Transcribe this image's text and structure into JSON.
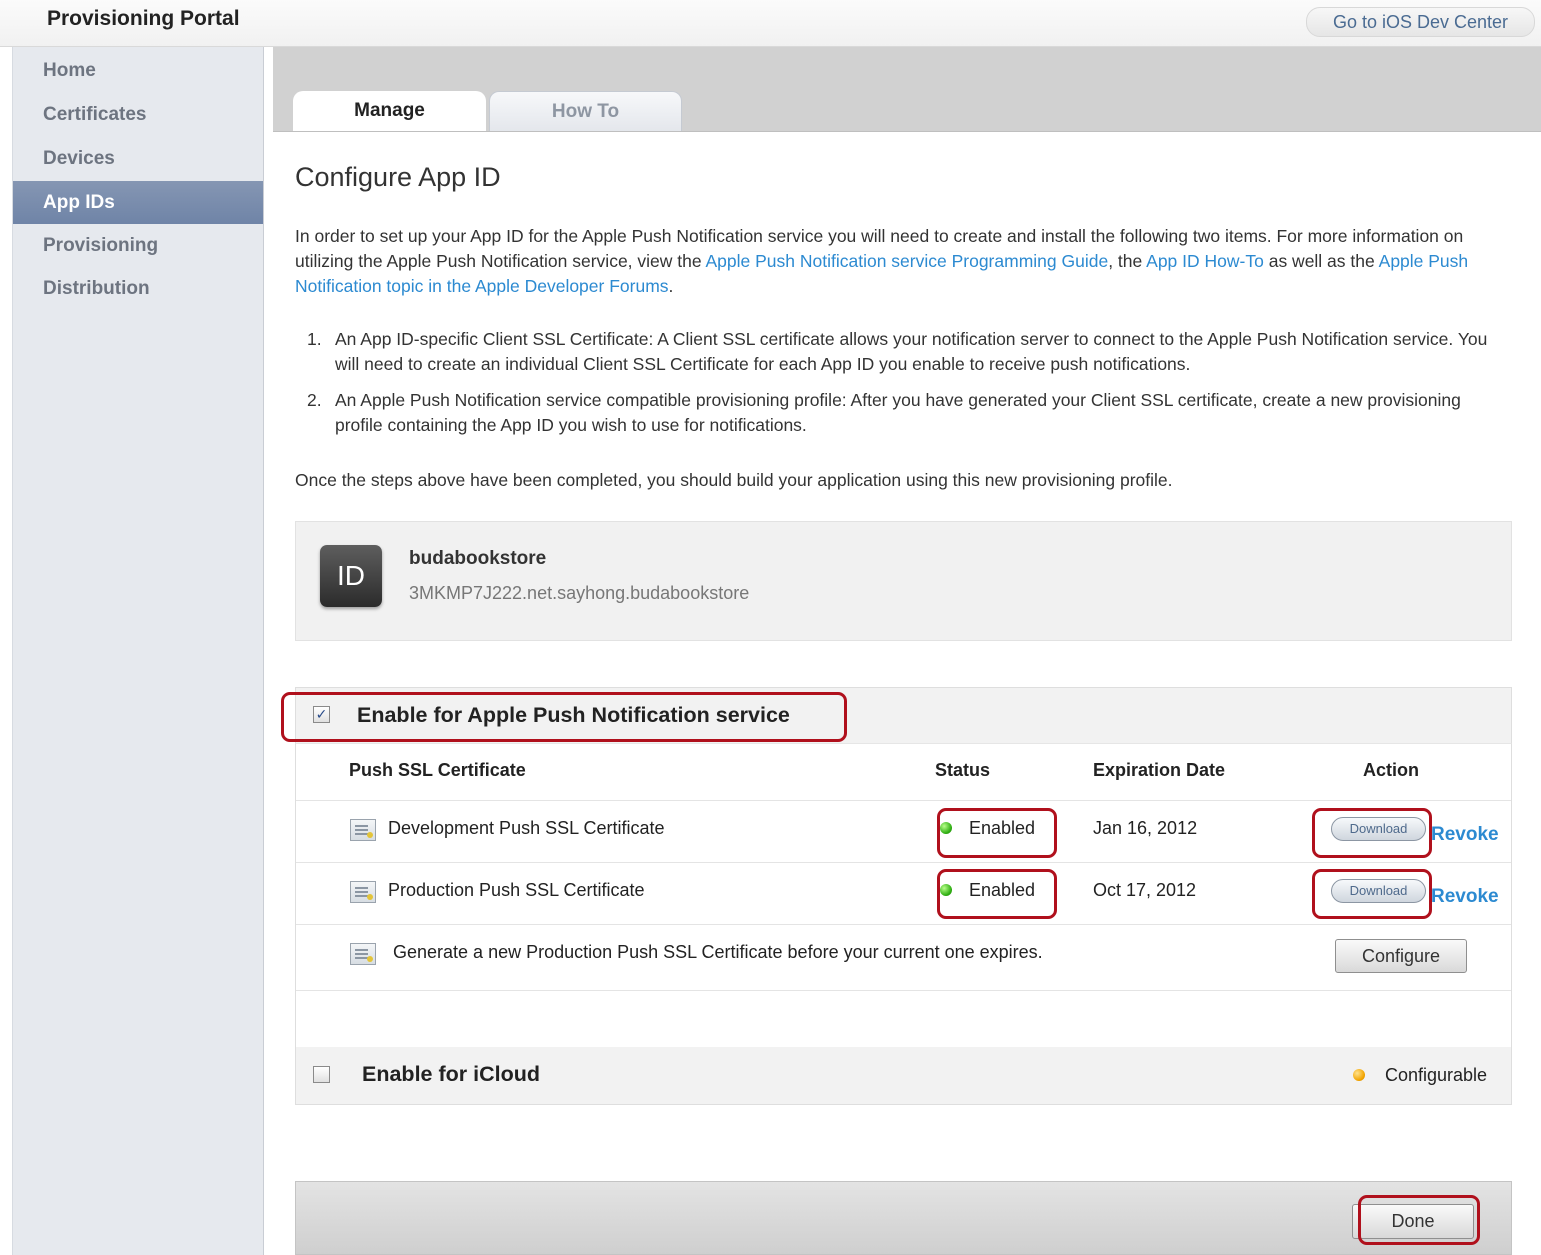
{
  "header": {
    "title": "Provisioning Portal",
    "dev_center_link": "Go to iOS Dev Center"
  },
  "sidebar": {
    "items": [
      {
        "label": "Home"
      },
      {
        "label": "Certificates"
      },
      {
        "label": "Devices"
      },
      {
        "label": "App IDs",
        "active": true
      },
      {
        "label": "Provisioning"
      },
      {
        "label": "Distribution"
      }
    ]
  },
  "tabs": [
    {
      "label": "Manage",
      "active": true
    },
    {
      "label": "How To"
    }
  ],
  "page": {
    "title": "Configure App ID",
    "intro": {
      "part1": "In order to set up your App ID for the Apple Push Notification service you will need to create and install the following two items. For more information on utilizing the Apple Push Notification service, view the ",
      "link1": "Apple Push Notification service Programming Guide",
      "part2": ", the ",
      "link2": "App ID How-To",
      "part3": " as well as the ",
      "link3": "Apple Push Notification topic in the Apple Developer Forums",
      "part4": "."
    },
    "steps": [
      {
        "num": "1.",
        "text": "An App ID-specific Client SSL Certificate: A Client SSL certificate allows your notification server to connect to the Apple Push Notification service. You will need to create an individual Client SSL Certificate for each App ID you enable to receive push notifications."
      },
      {
        "num": "2.",
        "text": "An Apple Push Notification service compatible provisioning profile: After you have generated your Client SSL certificate, create a new provisioning profile containing the App ID you wish to use for notifications."
      }
    ],
    "closing": "Once the steps above have been completed, you should build your application using this new provisioning profile."
  },
  "app": {
    "icon_text": "ID",
    "name": "budabookstore",
    "bundle_id": "3MKMP7J222.net.sayhong.budabookstore"
  },
  "push": {
    "checked": true,
    "label": "Enable for Apple Push Notification service",
    "columns": {
      "certificate": "Push SSL Certificate",
      "status": "Status",
      "expiration": "Expiration Date",
      "action": "Action"
    },
    "rows": [
      {
        "name": "Development Push SSL Certificate",
        "status": "Enabled",
        "expiration": "Jan 16, 2012",
        "download": "Download",
        "revoke": "Revoke"
      },
      {
        "name": "Production Push SSL Certificate",
        "status": "Enabled",
        "expiration": "Oct 17, 2012",
        "download": "Download",
        "revoke": "Revoke"
      }
    ],
    "generate_text": "Generate a new Production Push SSL Certificate before your current one expires.",
    "configure_label": "Configure"
  },
  "icloud": {
    "checked": false,
    "label": "Enable for iCloud",
    "status": "Configurable"
  },
  "footer": {
    "done_label": "Done"
  },
  "colors": {
    "link": "#2c8ad1",
    "sidebar_active": "#7588aa",
    "highlight": "#b0101c",
    "status_enabled": "#2fae12",
    "status_configurable": "#f2a400"
  }
}
